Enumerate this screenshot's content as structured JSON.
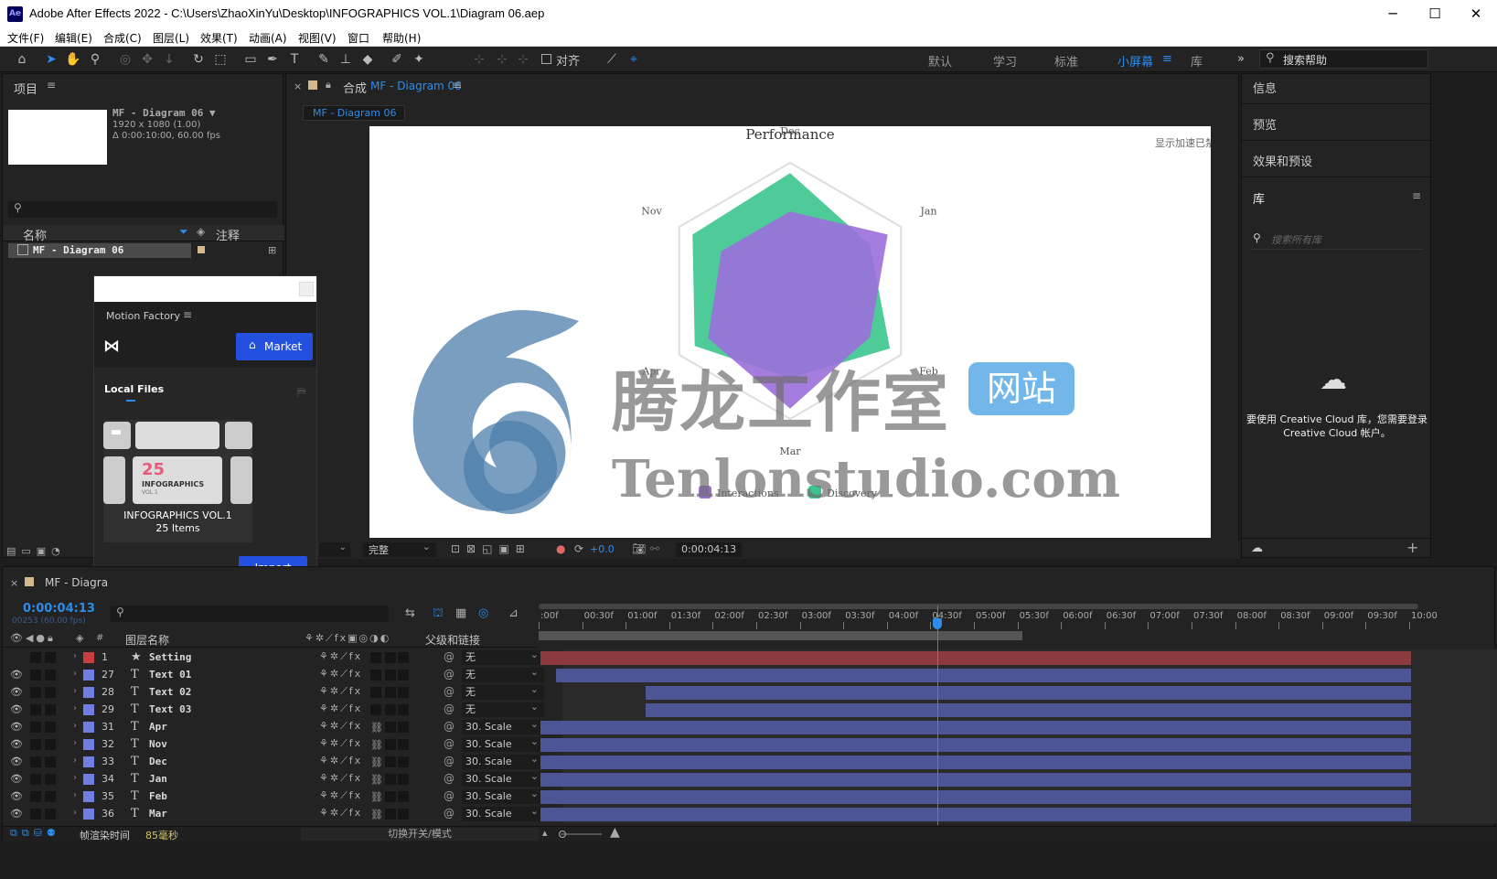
{
  "window": {
    "title": "Adobe After Effects 2022 - C:\\Users\\ZhaoXinYu\\Desktop\\INFOGRAPHICS VOL.1\\Diagram 06.aep",
    "app_icon": "Ae"
  },
  "menu": [
    "文件(F)",
    "编辑(E)",
    "合成(C)",
    "图层(L)",
    "效果(T)",
    "动画(A)",
    "视图(V)",
    "窗口",
    "帮助(H)"
  ],
  "toolbar": {
    "align_label": "对齐",
    "workspaces": [
      "默认",
      "学习",
      "标准",
      "小屏幕",
      "库"
    ],
    "active_workspace": "小屏幕",
    "search_placeholder": "搜索帮助"
  },
  "project_panel": {
    "title": "项目",
    "item_name": "MF - Diagram 06 ▼",
    "item_size": "1920 x 1080 (1.00)",
    "item_duration": "Δ 0:00:10:00, 60.00 fps",
    "col_name": "名称",
    "col_comment": "注释",
    "row_name": "MF - Diagram 06"
  },
  "comp_panel": {
    "tab_prefix": "合成",
    "tab_name": "MF - Diagram 06",
    "breadcrumb": "MF - Diagram 06",
    "notice": "显示加速已禁用",
    "quality": "完整",
    "exposure": "+0.0",
    "timecode": "0:00:04:13"
  },
  "motion_factory": {
    "title": "Motion Factory",
    "market_label": "Market",
    "local_files": "Local Files",
    "card_title": "INFOGRAPHICS VOL.1",
    "card_count": "25 Items",
    "thumb_num": "25",
    "thumb_word": "INFOGRAPHICS",
    "thumb_vol": "VOL.1",
    "import_label": "Import"
  },
  "right_panel": {
    "info": "信息",
    "preview": "预览",
    "effects": "效果和预设",
    "library": "库",
    "search_placeholder": "搜索所有库",
    "cc_message": "要使用 Creative Cloud 库，您需要登录 Creative Cloud 帐户。"
  },
  "watermark": {
    "cn": "腾龙工作室",
    "badge": "网站",
    "url": "Tenlonstudio.com"
  },
  "chart_data": {
    "type": "radar",
    "title": "Performance",
    "axes": [
      "Dec",
      "Jan",
      "Feb",
      "Mar",
      "Apr",
      "Nov"
    ],
    "series": [
      {
        "name": "Interactions",
        "color": "#9b6fdc",
        "values": [
          0.62,
          0.88,
          0.72,
          0.92,
          0.74,
          0.62
        ]
      },
      {
        "name": "Discovery",
        "color": "#3cc48e",
        "values": [
          0.92,
          0.72,
          0.9,
          0.68,
          0.86,
          0.88
        ]
      }
    ],
    "legend_position": "bottom"
  },
  "timeline": {
    "comp_tab": "MF - Diagra",
    "current_time": "0:00:04:13",
    "frame_info": "00253 (60.00 fps)",
    "col_layer_name": "图层名称",
    "col_parent": "父级和链接",
    "ruler": [
      ":00f",
      "00:30f",
      "01:00f",
      "01:30f",
      "02:00f",
      "02:30f",
      "03:00f",
      "03:30f",
      "04:00f",
      "04:30f",
      "05:00f",
      "05:30f",
      "06:00f",
      "06:30f",
      "07:00f",
      "07:30f",
      "08:00f",
      "08:30f",
      "09:00f",
      "09:30f",
      "10:00"
    ],
    "playhead_fraction": 0.4535,
    "work_area_end_fraction": 0.55,
    "layers": [
      {
        "num": "1",
        "type": "★",
        "name": "Setting",
        "parent": "无",
        "color": "#c83d3d",
        "start": 0.0,
        "end": 1.0,
        "bar": "red",
        "link": false
      },
      {
        "num": "27",
        "type": "T",
        "name": "Text 01",
        "parent": "无",
        "color": "#6f7ee0",
        "start": 0.018,
        "end": 1.0,
        "bar": "blue",
        "link": false
      },
      {
        "num": "28",
        "type": "T",
        "name": "Text 02",
        "parent": "无",
        "color": "#6f7ee0",
        "start": 0.12,
        "end": 1.0,
        "bar": "blue",
        "link": false
      },
      {
        "num": "29",
        "type": "T",
        "name": "Text 03",
        "parent": "无",
        "color": "#6f7ee0",
        "start": 0.12,
        "end": 1.0,
        "bar": "blue",
        "link": false
      },
      {
        "num": "31",
        "type": "T",
        "name": "Apr",
        "parent": "30. Scale",
        "color": "#6f7ee0",
        "start": 0.0,
        "end": 1.0,
        "bar": "blue",
        "link": true
      },
      {
        "num": "32",
        "type": "T",
        "name": "Nov",
        "parent": "30. Scale",
        "color": "#6f7ee0",
        "start": 0.0,
        "end": 1.0,
        "bar": "blue",
        "link": true
      },
      {
        "num": "33",
        "type": "T",
        "name": "Dec",
        "parent": "30. Scale",
        "color": "#6f7ee0",
        "start": 0.0,
        "end": 1.0,
        "bar": "blue",
        "link": true
      },
      {
        "num": "34",
        "type": "T",
        "name": "Jan",
        "parent": "30. Scale",
        "color": "#6f7ee0",
        "start": 0.0,
        "end": 1.0,
        "bar": "blue",
        "link": true
      },
      {
        "num": "35",
        "type": "T",
        "name": "Feb",
        "parent": "30. Scale",
        "color": "#6f7ee0",
        "start": 0.0,
        "end": 1.0,
        "bar": "blue",
        "link": true
      },
      {
        "num": "36",
        "type": "T",
        "name": "Mar",
        "parent": "30. Scale",
        "color": "#6f7ee0",
        "start": 0.0,
        "end": 1.0,
        "bar": "blue",
        "link": true
      }
    ],
    "render_label": "帧渲染时间",
    "render_value": "85毫秒",
    "toggle_label": "切换开关/模式"
  }
}
